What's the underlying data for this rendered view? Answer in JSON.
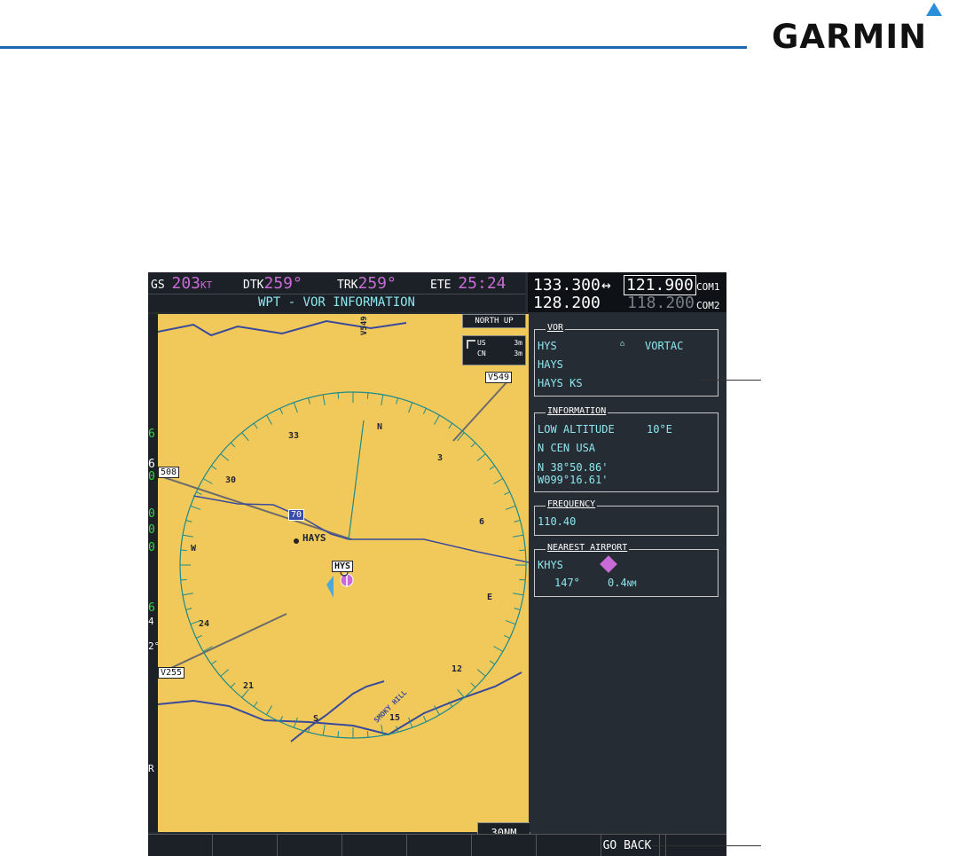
{
  "brand": {
    "name": "GARMIN",
    "mark_color": "#2a8fd8",
    "rule_color": "#1b67b0"
  },
  "status_bar": {
    "gs_label": "GS",
    "gs_value": "203",
    "gs_unit": "KT",
    "dtk_label": "DTK",
    "dtk_value": "259°",
    "trk_label": "TRK",
    "trk_value": "259°",
    "ete_label": "ETE",
    "ete_value": "25:24"
  },
  "page_title": "WPT - VOR INFORMATION",
  "com_radios": {
    "com1_active": "133.300",
    "swap": "↔",
    "com1_standby": "121.900",
    "com1_label": "COM1",
    "com2_active": "128.200",
    "com2_standby": "118.200",
    "com2_label": "COM2"
  },
  "map": {
    "orientation": "NORTH UP",
    "legend": [
      {
        "label": "US",
        "value": "3m"
      },
      {
        "label": "CN",
        "value": "3m"
      }
    ],
    "airways": [
      "V549",
      "508",
      "V255"
    ],
    "highway": "70",
    "city": "HAYS",
    "vor_label": "HYS",
    "river": "SMOKY HILL",
    "compass_labels": [
      "N",
      "3",
      "6",
      "E",
      "12",
      "15",
      "S",
      "21",
      "24",
      "W",
      "30",
      "33"
    ],
    "range": "30NM",
    "left_strip": [
      "6",
      "6",
      "0",
      "0",
      "0",
      "0",
      "6",
      "4",
      "2°",
      "R"
    ]
  },
  "vor": {
    "header": "VOR",
    "ident": "HYS",
    "type": "VORTAC",
    "name": "HAYS",
    "city": "HAYS KS"
  },
  "information": {
    "header": "INFORMATION",
    "class": "LOW ALTITUDE",
    "magvar": "10°E",
    "region": "N CEN USA",
    "lat": "N 38°50.86'",
    "lon": "W099°16.61'"
  },
  "frequency": {
    "header": "FREQUENCY",
    "value": "110.40"
  },
  "nearest_airport": {
    "header": "NEAREST AIRPORT",
    "ident": "KHYS",
    "bearing": "147°",
    "distance": "0.4",
    "distance_unit": "NM"
  },
  "softkeys": [
    "",
    "",
    "",
    "",
    "",
    "",
    "",
    "",
    "",
    "GO BACK",
    "",
    ""
  ],
  "colors": {
    "map_land": "#f1c95b",
    "cyan_text": "#8ee6ee",
    "magenta": "#c86bd6",
    "panel": "#262c33",
    "bar": "#1c2127"
  }
}
